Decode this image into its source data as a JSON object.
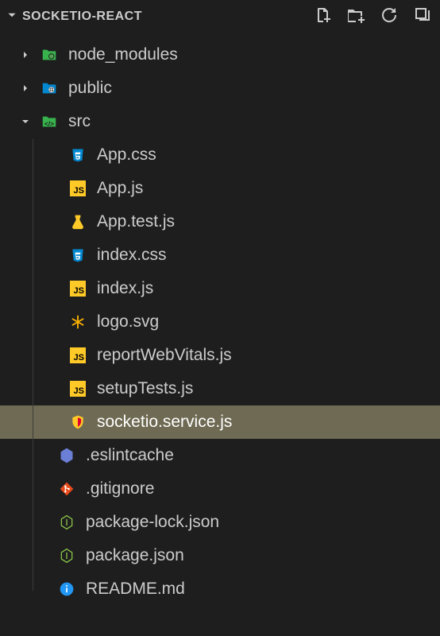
{
  "header": {
    "title": "SOCKETIO-REACT"
  },
  "tree": [
    {
      "name": "node_modules",
      "icon": "folder-node",
      "depth": 0,
      "expanded": false,
      "type": "folder"
    },
    {
      "name": "public",
      "icon": "folder-public",
      "depth": 0,
      "expanded": false,
      "type": "folder"
    },
    {
      "name": "src",
      "icon": "folder-src",
      "depth": 0,
      "expanded": true,
      "type": "folder"
    },
    {
      "name": "App.css",
      "icon": "css",
      "depth": 1,
      "type": "file"
    },
    {
      "name": "App.js",
      "icon": "js",
      "depth": 1,
      "type": "file"
    },
    {
      "name": "App.test.js",
      "icon": "test",
      "depth": 1,
      "type": "file"
    },
    {
      "name": "index.css",
      "icon": "css",
      "depth": 1,
      "type": "file"
    },
    {
      "name": "index.js",
      "icon": "js",
      "depth": 1,
      "type": "file"
    },
    {
      "name": "logo.svg",
      "icon": "svg",
      "depth": 1,
      "type": "file"
    },
    {
      "name": "reportWebVitals.js",
      "icon": "js",
      "depth": 1,
      "type": "file"
    },
    {
      "name": "setupTests.js",
      "icon": "js",
      "depth": 1,
      "type": "file"
    },
    {
      "name": "socketio.service.js",
      "icon": "shield",
      "depth": 1,
      "type": "file",
      "selected": true
    },
    {
      "name": ".eslintcache",
      "icon": "hex",
      "depth": 0,
      "type": "file",
      "noChevron": true
    },
    {
      "name": ".gitignore",
      "icon": "git",
      "depth": 0,
      "type": "file",
      "noChevron": true
    },
    {
      "name": "package-lock.json",
      "icon": "node",
      "depth": 0,
      "type": "file",
      "noChevron": true
    },
    {
      "name": "package.json",
      "icon": "node",
      "depth": 0,
      "type": "file",
      "noChevron": true
    },
    {
      "name": "README.md",
      "icon": "info",
      "depth": 0,
      "type": "file",
      "noChevron": true
    }
  ]
}
